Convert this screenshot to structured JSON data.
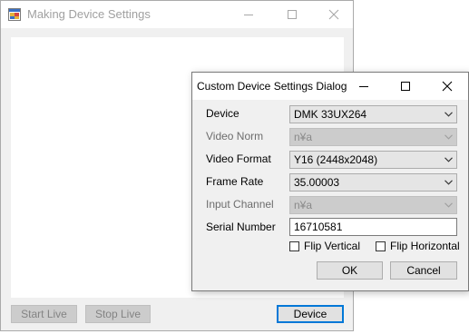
{
  "main_window": {
    "title": "Making Device Settings",
    "icon": "app-window-icon",
    "buttons": {
      "start_live": "Start Live",
      "stop_live": "Stop Live",
      "device": "Device"
    }
  },
  "dialog": {
    "title": "Custom Device Settings Dialog",
    "fields": {
      "device": {
        "label": "Device",
        "value": "DMK 33UX264"
      },
      "video_norm": {
        "label": "Video Norm",
        "value": "n¥a"
      },
      "video_format": {
        "label": "Video Format",
        "value": "Y16 (2448x2048)"
      },
      "frame_rate": {
        "label": "Frame Rate",
        "value": "35.00003"
      },
      "input_channel": {
        "label": "Input Channel",
        "value": "n¥a"
      },
      "serial_number": {
        "label": "Serial Number",
        "value": "16710581"
      }
    },
    "checkboxes": {
      "flip_vertical": {
        "label": "Flip Vertical",
        "checked": false
      },
      "flip_horizontal": {
        "label": "Flip Horizontal",
        "checked": false
      }
    },
    "buttons": {
      "ok": "OK",
      "cancel": "Cancel"
    }
  },
  "colors": {
    "window_bg": "#f0f0f0",
    "titlebar_bg": "#ffffff",
    "default_button_border": "#0078d7",
    "disabled_text": "#838383"
  }
}
